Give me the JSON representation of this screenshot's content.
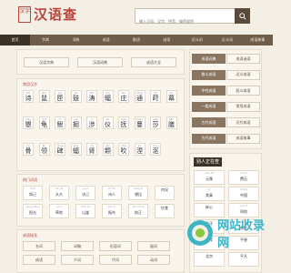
{
  "header": {
    "seal_text": "汉字",
    "title": "汉语查",
    "search_placeholder": "输入汉语、汉字、拼音、偏旁部首",
    "search_icon": "search-icon"
  },
  "nav": [
    "首页",
    "字典",
    "词典",
    "成语",
    "歇语",
    "谜语",
    "近义词",
    "反义词",
    "成语故事"
  ],
  "dict_links": [
    "汉语字典",
    "汉语词典",
    "成语大全"
  ],
  "common_chars": {
    "title": "常用汉字",
    "rows": [
      [
        {
          "py": "shī",
          "ch": "诗"
        },
        {
          "py": "shǔ",
          "ch": "鼠"
        },
        {
          "py": "xiá",
          "ch": "匣"
        },
        {
          "py": "gǔ",
          "ch": "鼓"
        },
        {
          "py": "tāo",
          "ch": "涛"
        },
        {
          "py": "yóu",
          "ch": "蝠"
        },
        {
          "py": "zhí",
          "ch": "庄"
        },
        {
          "py": "tōng",
          "ch": "通"
        },
        {
          "py": "shí",
          "ch": "莳"
        },
        {
          "py": "mù",
          "ch": "幕"
        }
      ],
      [
        {
          "py": "xiào",
          "ch": "曌"
        },
        {
          "py": "guī",
          "ch": "龟"
        },
        {
          "py": "ní",
          "ch": "鲵"
        },
        {
          "py": "jué",
          "ch": "掘"
        },
        {
          "py": "jí",
          "ch": "涉"
        },
        {
          "py": "jiū",
          "ch": "仪"
        },
        {
          "py": "pán",
          "ch": "抚"
        },
        {
          "py": "biān",
          "ch": "蔓"
        },
        {
          "py": "xiāo",
          "ch": "莎"
        },
        {
          "py": "jiān",
          "ch": "膳"
        }
      ],
      [
        {
          "py": "fú",
          "ch": "骨"
        },
        {
          "py": "lín",
          "ch": "领"
        },
        {
          "py": "tōng",
          "ch": "碑"
        },
        {
          "py": "jīng",
          "ch": "蝠"
        },
        {
          "py": "dù",
          "ch": "肾"
        },
        {
          "py": "jiǎo",
          "ch": "颗"
        },
        {
          "py": "zhé",
          "ch": "吹"
        },
        {
          "py": "liú",
          "ch": "湮"
        },
        {
          "py": "kǒu",
          "ch": "沤"
        },
        {
          "py": "",
          "ch": ""
        }
      ]
    ]
  },
  "hot_words": {
    "title": "热门词语",
    "items": [
      {
        "py": "zhī jǐ",
        "w": "知己"
      },
      {
        "py": "tóu dà",
        "w": "头大"
      },
      {
        "py": "jué jǐ",
        "w": "决己"
      },
      {
        "py": "shī rén",
        "w": "诗人"
      },
      {
        "py": "xiǎng bǐ",
        "w": "想比"
      },
      {
        "py": "",
        "w": "何况"
      },
      {
        "py": "yǎng guāng",
        "w": "阳光"
      },
      {
        "py": "tuō lǐ",
        "w": "草地"
      },
      {
        "py": "shān yá",
        "w": "山崖"
      },
      {
        "py": "bǎo jiù",
        "w": "报舟"
      },
      {
        "py": "jiǎo zhèng",
        "w": "绞正"
      },
      {
        "py": "",
        "w": "饮食"
      }
    ]
  },
  "hot_idioms": {
    "title": "成语接龙",
    "items": [
      {
        "py": "",
        "w": "名词"
      },
      {
        "py": "",
        "w": "词翰"
      },
      {
        "py": "",
        "w": "形容词"
      },
      {
        "py": "",
        "w": "副词"
      },
      {
        "py": "",
        "w": "成语"
      },
      {
        "py": "",
        "w": "介词"
      },
      {
        "py": "",
        "w": "代词"
      },
      {
        "py": "",
        "w": "动词"
      }
    ]
  },
  "side_menu": [
    {
      "left": "成语词典",
      "right": "成语谜语"
    },
    {
      "left": "歇义成语",
      "right": "近义成语"
    },
    {
      "left": "中性成语",
      "right": "贬义成语"
    },
    {
      "left": "一般成语",
      "right": "常用成语"
    },
    {
      "left": "古代成语",
      "right": "近代成语"
    },
    {
      "left": "古代成语",
      "right": "成语故事"
    }
  ],
  "side_words": {
    "title": "别人正在查",
    "items": [
      {
        "py": "yuán shì",
        "w": "元殊"
      },
      {
        "py": "fèi shì",
        "w": "费石"
      },
      {
        "py": "qī",
        "w": "其鼻"
      },
      {
        "py": "zhōng",
        "w": "中国"
      },
      {
        "py": "",
        "w": "碎心"
      },
      {
        "py": "tóng dì",
        "w": "同地"
      },
      {
        "py": "",
        "w": "秀牙"
      },
      {
        "py": "xiǎng",
        "w": "想忆"
      },
      {
        "py": "",
        "w": "南岸"
      },
      {
        "py": "",
        "w": "平昼"
      },
      {
        "py": "",
        "w": "北京"
      },
      {
        "py": "",
        "w": "平凡"
      }
    ]
  },
  "watermark": "网站收录网"
}
